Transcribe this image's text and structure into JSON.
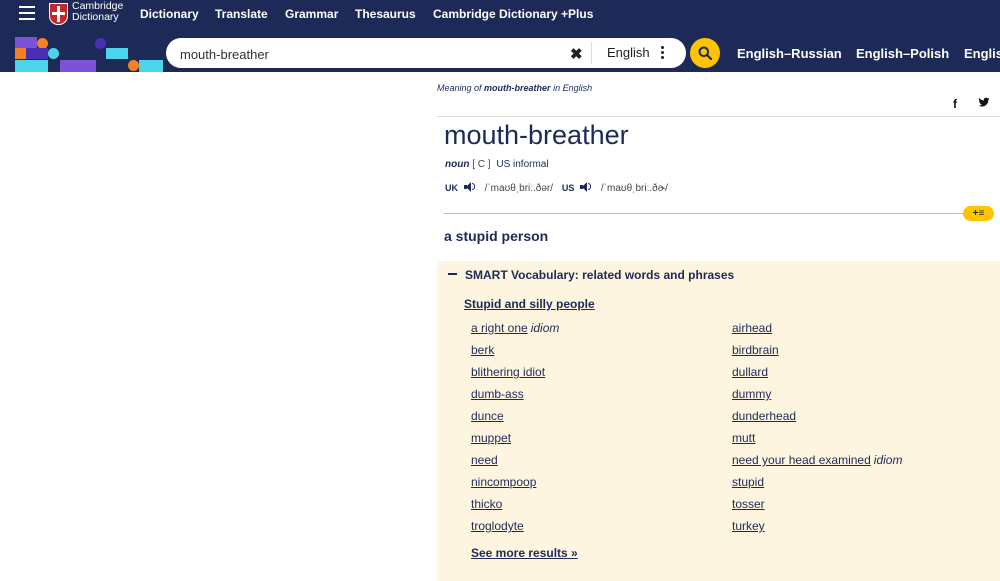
{
  "nav": {
    "logo_line1": "Cambridge",
    "logo_line2": "Dictionary",
    "items": [
      "Dictionary",
      "Translate",
      "Grammar",
      "Thesaurus",
      "Cambridge Dictionary +Plus"
    ]
  },
  "search": {
    "value": "mouth-breather",
    "clear_icon": "close-icon",
    "language": "English",
    "quick_links": [
      "English–Russian",
      "English–Polish",
      "Englis"
    ]
  },
  "colors": {
    "navy": "#1d2a57",
    "accent_yellow": "#fec400",
    "smart_bg": "#fef5e0"
  },
  "entry": {
    "breadcrumb_prefix": "Meaning of",
    "breadcrumb_word": "mouth-breather",
    "breadcrumb_suffix": "in English",
    "headword": "mouth-breather",
    "pos": "noun",
    "grammar": "[ C ]",
    "usage": "US informal",
    "uk_label": "UK",
    "uk_ipa": "/ˈmaʊθˌbriː.ðər/",
    "us_label": "US",
    "us_ipa": "/ˈmaʊθˌbriː.ðɚ/",
    "definition": "a stupid person"
  },
  "smart_vocab": {
    "heading": "SMART Vocabulary: related words and phrases",
    "topic": "Stupid and silly people",
    "left_col": [
      {
        "word": "a right one",
        "tag": "idiom"
      },
      {
        "word": "berk",
        "tag": ""
      },
      {
        "word": "blithering idiot",
        "tag": ""
      },
      {
        "word": "dumb-ass",
        "tag": ""
      },
      {
        "word": "dunce",
        "tag": ""
      },
      {
        "word": "muppet",
        "tag": ""
      },
      {
        "word": "need",
        "tag": ""
      },
      {
        "word": "nincompoop",
        "tag": ""
      },
      {
        "word": "thicko",
        "tag": ""
      },
      {
        "word": "troglodyte",
        "tag": ""
      }
    ],
    "right_col": [
      {
        "word": "airhead",
        "tag": ""
      },
      {
        "word": "birdbrain",
        "tag": ""
      },
      {
        "word": "dullard",
        "tag": ""
      },
      {
        "word": "dummy",
        "tag": ""
      },
      {
        "word": "dunderhead",
        "tag": ""
      },
      {
        "word": "mutt",
        "tag": ""
      },
      {
        "word": "need your head examined",
        "tag": "idiom"
      },
      {
        "word": "stupid",
        "tag": ""
      },
      {
        "word": "tosser",
        "tag": ""
      },
      {
        "word": "turkey",
        "tag": ""
      }
    ],
    "see_more": "See more results »"
  }
}
